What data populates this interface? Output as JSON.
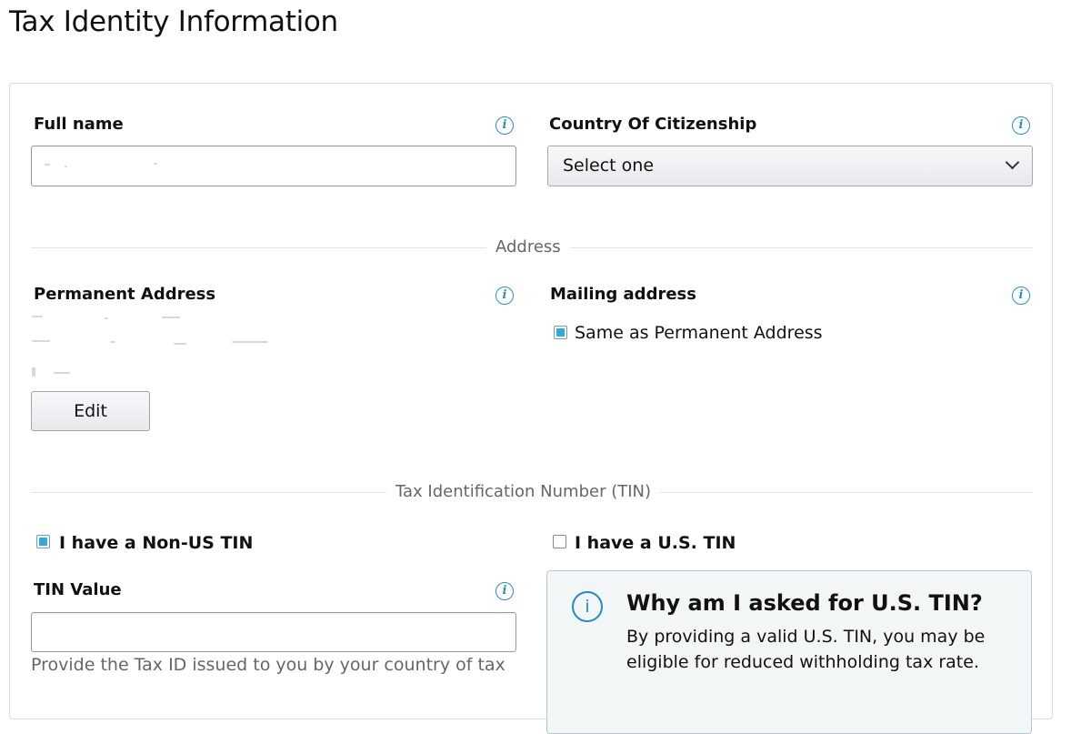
{
  "page": {
    "title": "Tax Identity Information"
  },
  "identity": {
    "full_name_label": "Full name",
    "full_name_value": "",
    "country_label": "Country Of Citizenship",
    "country_selected": "Select one"
  },
  "address_section": {
    "divider": "Address",
    "permanent_label": "Permanent Address",
    "edit_button": "Edit",
    "mailing_label": "Mailing address",
    "same_as_permanent_label": "Same as Permanent Address",
    "same_as_permanent_checked": true
  },
  "tin_section": {
    "divider": "Tax Identification Number (TIN)",
    "non_us_tin_label": "I have a Non-US TIN",
    "non_us_tin_checked": true,
    "us_tin_label": "I have a U.S. TIN",
    "us_tin_checked": false,
    "tin_value_label": "TIN Value",
    "tin_value": "",
    "tin_helper": "Provide the Tax ID issued to you by your country of tax",
    "info_title": "Why am I asked for U.S. TIN?",
    "info_body": "By providing a valid U.S. TIN, you may be eligible for reduced withholding tax rate."
  },
  "icons": {
    "info": "info-icon",
    "dropdown": "chevron-down-icon"
  },
  "colors": {
    "accent": "#2a8fbf",
    "checkbox_fill": "#34a7dd",
    "info_box_bg": "#f3f6f6"
  }
}
